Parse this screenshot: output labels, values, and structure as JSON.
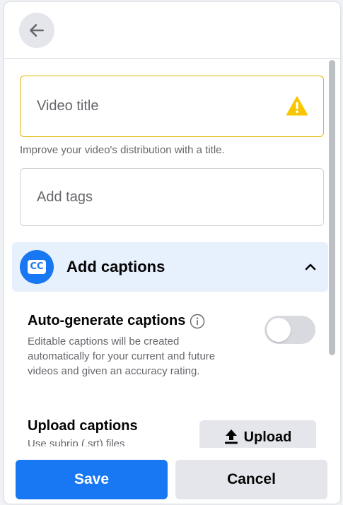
{
  "form": {
    "video_title_placeholder": "Video title",
    "title_helper": "Improve your video's distribution with a title.",
    "tags_placeholder": "Add tags"
  },
  "captions": {
    "badge": "CC",
    "title": "Add captions",
    "auto_generate": {
      "title": "Auto-generate captions",
      "description": "Editable captions will be created automatically for your current and future videos and given an accuracy rating.",
      "enabled": false
    },
    "upload": {
      "title": "Upload captions",
      "description": "Use subrip (.srt) files",
      "button_label": "Upload"
    }
  },
  "footer": {
    "save_label": "Save",
    "cancel_label": "Cancel"
  },
  "icons": {
    "back": "arrow-left-icon",
    "warning": "warning-triangle-icon",
    "chevron": "chevron-up-icon",
    "info": "info-icon",
    "upload": "upload-arrow-icon"
  },
  "colors": {
    "primary": "#1877f2",
    "warning_border": "#e5b500",
    "warning_icon": "#f7c600",
    "captions_bg": "#e7f0fd"
  }
}
